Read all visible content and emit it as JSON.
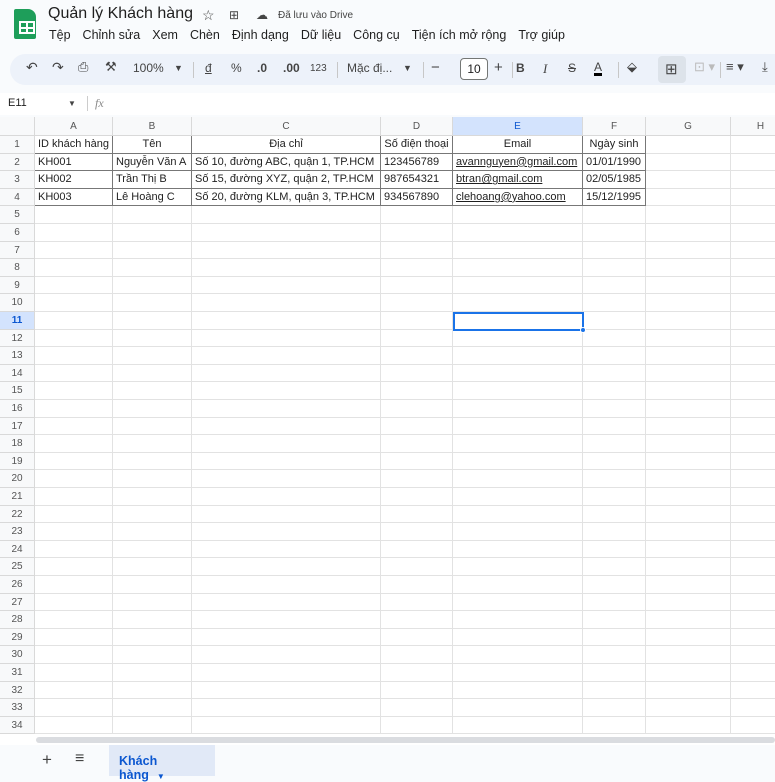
{
  "header": {
    "title": "Quản lý Khách hàng",
    "saved_status": "Đã lưu vào Drive"
  },
  "menu": [
    "Tệp",
    "Chỉnh sửa",
    "Xem",
    "Chèn",
    "Định dạng",
    "Dữ liệu",
    "Công cụ",
    "Tiện ích mở rộng",
    "Trợ giúp"
  ],
  "toolbar": {
    "zoom": "100%",
    "currency": "đ",
    "percent": "%",
    "dec_decrease": ".0",
    "dec_increase": ".00",
    "number_format": "123",
    "font": "Mặc đị...",
    "font_size": "10",
    "bold": "B",
    "italic": "I",
    "text_color": "A"
  },
  "formula_bar": {
    "name_box": "E11",
    "fx": "fx",
    "value": ""
  },
  "grid": {
    "columns": [
      "A",
      "B",
      "C",
      "D",
      "E",
      "F",
      "G",
      "H"
    ],
    "row_count": 34,
    "selected_cell": "E11",
    "rows": [
      [
        "ID khách hàng",
        "Tên",
        "Địa chỉ",
        "Số điện thoại",
        "Email",
        "Ngày sinh"
      ],
      [
        "KH001",
        "Nguyễn Văn A",
        "Số 10, đường ABC, quận 1, TP.HCM",
        "123456789",
        "avannguyen@gmail.com",
        "01/01/1990"
      ],
      [
        "KH002",
        "Trần Thị B",
        "Số 15, đường XYZ, quận 2, TP.HCM",
        "987654321",
        "btran@gmail.com",
        "02/05/1985"
      ],
      [
        "KH003",
        "Lê Hoàng C",
        "Số 20, đường KLM, quận 3, TP.HCM",
        "934567890",
        "clehoang@yahoo.com",
        "15/12/1995"
      ]
    ]
  },
  "sheets": [
    {
      "name": "Khách hàng",
      "active": true
    }
  ]
}
